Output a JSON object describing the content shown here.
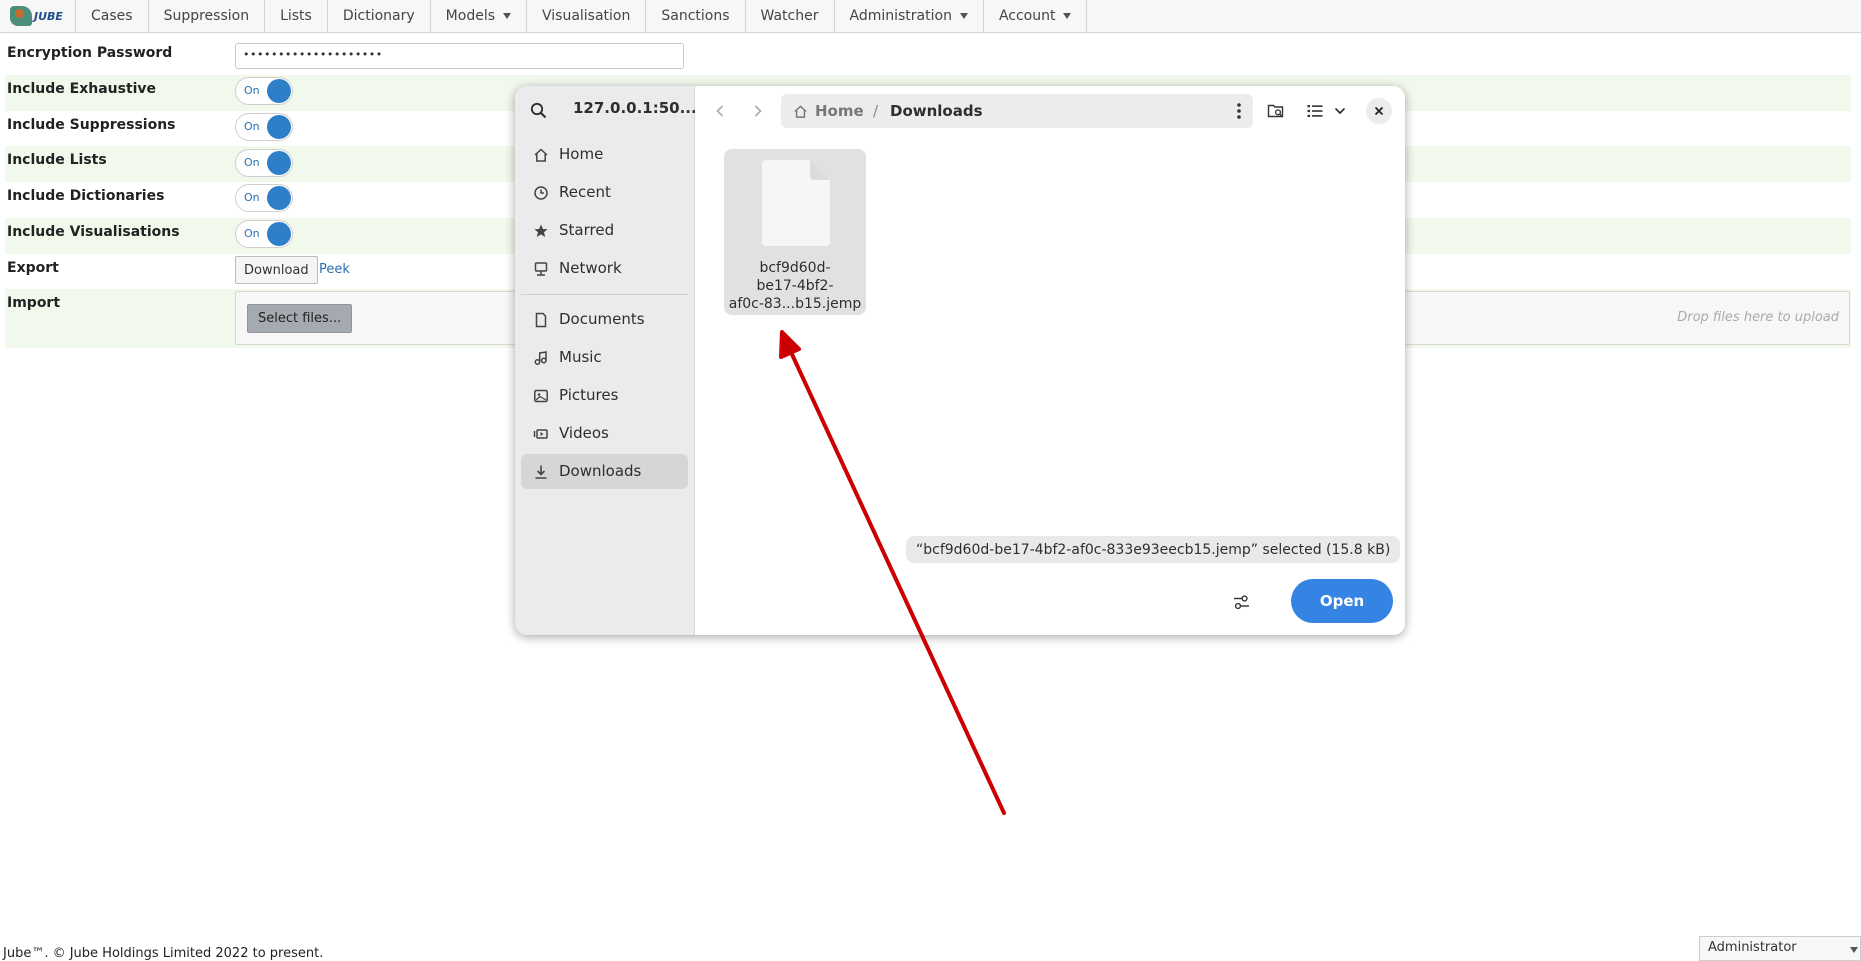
{
  "app": {
    "logo_text": "JUBE",
    "menu": [
      {
        "label": "Cases",
        "dropdown": false
      },
      {
        "label": "Suppression",
        "dropdown": false
      },
      {
        "label": "Lists",
        "dropdown": false
      },
      {
        "label": "Dictionary",
        "dropdown": false
      },
      {
        "label": "Models",
        "dropdown": true
      },
      {
        "label": "Visualisation",
        "dropdown": false
      },
      {
        "label": "Sanctions",
        "dropdown": false
      },
      {
        "label": "Watcher",
        "dropdown": false
      },
      {
        "label": "Administration",
        "dropdown": true
      },
      {
        "label": "Account",
        "dropdown": true
      }
    ]
  },
  "form": {
    "encryption_password": {
      "label": "Encryption Password",
      "value": "••••••••••••••••••••"
    },
    "include_exhaustive": {
      "label": "Include Exhaustive",
      "state": "On"
    },
    "include_suppressions": {
      "label": "Include Suppressions",
      "state": "On"
    },
    "include_lists": {
      "label": "Include Lists",
      "state": "On"
    },
    "include_dictionaries": {
      "label": "Include Dictionaries",
      "state": "On"
    },
    "include_visualisations": {
      "label": "Include Visualisations",
      "state": "On"
    },
    "export": {
      "label": "Export",
      "download_label": "Download",
      "peek_label": "Peek"
    },
    "import": {
      "label": "Import",
      "select_label": "Select files...",
      "drop_hint": "Drop files here to upload"
    }
  },
  "footer": {
    "copyright": "Jube™. © Jube Holdings Limited 2022 to present.",
    "user": "Administrator"
  },
  "dialog": {
    "location_title": "127.0.0.1:50...",
    "places": [
      {
        "label": "Home",
        "icon": "home-icon"
      },
      {
        "label": "Recent",
        "icon": "clock-icon"
      },
      {
        "label": "Starred",
        "icon": "star-icon"
      },
      {
        "label": "Network",
        "icon": "network-icon"
      },
      {
        "label": "Documents",
        "icon": "document-icon"
      },
      {
        "label": "Music",
        "icon": "music-icon"
      },
      {
        "label": "Pictures",
        "icon": "picture-icon"
      },
      {
        "label": "Videos",
        "icon": "video-icon"
      },
      {
        "label": "Downloads",
        "icon": "download-icon",
        "active": true
      }
    ],
    "path": {
      "home": "Home",
      "separator": "/",
      "current": "Downloads"
    },
    "file": {
      "name_lines": [
        "bcf9d60d-",
        "be17-4bf2-",
        "af0c-83...b15.jemp"
      ]
    },
    "status": "“bcf9d60d-be17-4bf2-af0c-833e93eecb15.jemp” selected  (15.8 kB)",
    "open_label": "Open"
  },
  "colors": {
    "accent": "#3584e4",
    "toggle": "#2f7fc8",
    "annotation_arrow": "#cc0000",
    "row_alt": "#f1f8ec"
  }
}
